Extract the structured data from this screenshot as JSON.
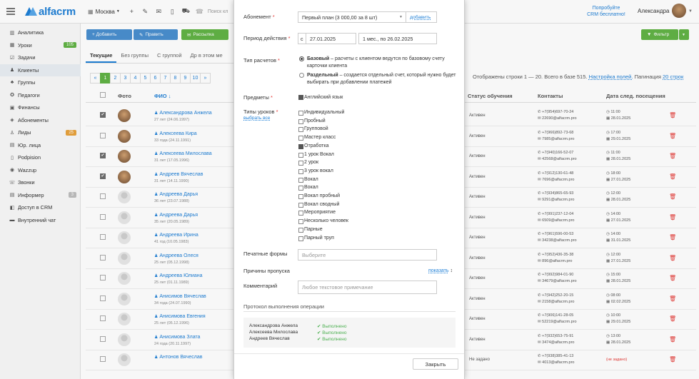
{
  "topbar": {
    "logo": "alfacrm",
    "branch": "Москва",
    "search_placeholder": "Поиск кл",
    "try_free": "Попробуйте CRM бесплатно!",
    "user": "Александра"
  },
  "sidebar": {
    "items": [
      {
        "icon": "chart-icon",
        "label": "Аналитика"
      },
      {
        "icon": "calendar-icon",
        "label": "Уроки",
        "badge": "105",
        "badge_color": "#62b346"
      },
      {
        "icon": "check-icon",
        "label": "Задачи"
      },
      {
        "icon": "user-icon",
        "label": "Клиенты"
      },
      {
        "icon": "group-icon",
        "label": "Группы"
      },
      {
        "icon": "teacher-icon",
        "label": "Педагоги"
      },
      {
        "icon": "money-icon",
        "label": "Финансы"
      },
      {
        "icon": "ticket-icon",
        "label": "Абонементы"
      },
      {
        "icon": "lead-icon",
        "label": "Лиды",
        "badge": "25",
        "badge_color": "#e8a33d"
      },
      {
        "icon": "building-icon",
        "label": "Юр. лица"
      },
      {
        "icon": "doc-icon",
        "label": "Podpision"
      },
      {
        "icon": "chat-icon",
        "label": "Wazzup"
      },
      {
        "icon": "phone-icon",
        "label": "Звонки"
      },
      {
        "icon": "info-icon",
        "label": "Информер",
        "badge": "3",
        "badge_color": "#bdbdbd"
      },
      {
        "icon": "lock-icon",
        "label": "Доступ в CRM"
      },
      {
        "icon": "chat-bubble-icon",
        "label": "Внутренний чат"
      }
    ]
  },
  "list": {
    "toolbar": {
      "add": "+ Добавить",
      "edit": "Править",
      "mailing": "Рассылка",
      "filter": "Фильтр"
    },
    "tabs": [
      "Текущие",
      "Без группы",
      "С группой",
      "Др в этом ме"
    ],
    "pages": [
      "«",
      "1",
      "2",
      "3",
      "4",
      "5",
      "6",
      "7",
      "8",
      "9",
      "10",
      "»"
    ],
    "stats_text": "Отображены строки 1 — 20. Всего в базе 515.",
    "stats_link": "Настройка полей.",
    "stats_pag": "Пагинация",
    "stats_pag_link": "20 строк",
    "headers": {
      "photo": "Фото",
      "fio": "ФИО ↓",
      "status": "Статус обучения",
      "contacts": "Контакты",
      "next": "Дата след. посещения"
    },
    "rows": [
      {
        "name": "Александрова Анжела",
        "age": "27 лет (24.06.1997)",
        "checked": true,
        "photo": true,
        "status": "Активен",
        "phone": "+7(954)697-70-24",
        "email": "22690@alfacrm.pro",
        "time": "11:00",
        "date": "28.01.2025"
      },
      {
        "name": "Алексеева Кира",
        "age": "33 года (24.11.1991)",
        "checked": false,
        "photo": true,
        "status": "Активен",
        "phone": "+7(966)892-73-68",
        "email": "7985@alfacrm.pro",
        "time": "17:00",
        "date": "29.01.2025"
      },
      {
        "name": "Алексеева Милослава",
        "age": "31 лет (17.05.1996)",
        "checked": true,
        "photo": true,
        "status": "Активен",
        "phone": "+7(940)166-52-07",
        "email": "42568@alfacrm.pro",
        "time": "11:00",
        "date": "28.01.2025"
      },
      {
        "name": "Андреев Вячеслав",
        "age": "31 лет (14.11.1990)",
        "checked": true,
        "photo": true,
        "status": "Активен",
        "phone": "+7(912)130-61-48",
        "email": "7696@alfacrm.pro",
        "time": "18:00",
        "date": "27.01.2025"
      },
      {
        "name": "Андреева Дарья",
        "age": "36 лет (23.07.1988)",
        "checked": false,
        "photo": false,
        "status": "Активен",
        "phone": "+7(934)865-65-93",
        "email": "9291@alfacrm.pro",
        "time": "12:00",
        "date": "28.01.2025"
      },
      {
        "name": "Андреева Дарья",
        "age": "35 лет (20.05.1989)",
        "checked": false,
        "photo": false,
        "status": "Активен",
        "phone": "+7(991)237-12-04",
        "email": "6509@alfacrm.pro",
        "time": "14:00",
        "date": "27.01.2025"
      },
      {
        "name": "Андреева Ирина",
        "age": "41 год (10.05.1983)",
        "checked": false,
        "photo": false,
        "status": "Активен",
        "phone": "+7(961)596-00-53",
        "email": "34238@alfacrm.pro",
        "time": "14:00",
        "date": "31.01.2025"
      },
      {
        "name": "Андреева Олеся",
        "age": "25 лет (05.12.1998)",
        "checked": false,
        "photo": false,
        "status": "Активен",
        "phone": "+7(952)436-35-38",
        "email": "896@alfacrm.pro",
        "time": "12:00",
        "date": "27.01.2025"
      },
      {
        "name": "Андреева Юлиана",
        "age": "25 лет (01.11.1989)",
        "checked": false,
        "photo": false,
        "status": "Активен",
        "phone": "+7(992)984-01-90",
        "email": "34679@alfacrm.pro",
        "time": "15:00",
        "date": "28.01.2025"
      },
      {
        "name": "Анисимов Вячеслав",
        "age": "34 года (24.07.1990)",
        "checked": false,
        "photo": false,
        "status": "Активен",
        "phone": "+7(942)252-20-15",
        "email": "2158@alfacrm.pro",
        "time": "08:00",
        "date": "02.02.2025"
      },
      {
        "name": "Анисимова Евгения",
        "age": "25 лет (05.12.1996)",
        "checked": false,
        "photo": false,
        "status": "Активен",
        "phone": "+7(906)141-28-05",
        "email": "52219@alfacrm.pro",
        "time": "10:00",
        "date": "29.01.2025"
      },
      {
        "name": "Анисимова Злата",
        "age": "24 года (20.11.1997)",
        "checked": false,
        "photo": false,
        "status": "Активен",
        "phone": "+7(932)653-75-91",
        "email": "3474@alfacrm.pro",
        "time": "13:00",
        "date": "28.01.2025"
      },
      {
        "name": "Антонов Вячеслав",
        "age": "",
        "checked": false,
        "photo": false,
        "status": "Не задано",
        "phone": "+7(938)385-41-13",
        "email": "4013@alfacrm.pro",
        "time": "",
        "date": "(не задано)"
      }
    ]
  },
  "modal": {
    "abonement_label": "Абонемент",
    "abonement_value": "Первый план (3 000,00 за 8 шт)",
    "add_link": "добавить",
    "period_label": "Период действия",
    "period_prefix": "с",
    "period_start": "27.01.2025",
    "period_end": "1 мес., по 26.02.2025",
    "calc_label": "Тип расчетов",
    "calc_base_bold": "Базовый",
    "calc_base_text": " – расчеты с клиентом ведутся по базовому счету карточки клиента",
    "calc_sep_bold": "Раздельный",
    "calc_sep_text": " – создается отдельный счет, который нужно будет выбирать при добавлении платежей",
    "subjects_label": "Предметы",
    "subject": "Английский язык",
    "lesson_types_label": "Типы уроков",
    "select_all": "выбрать все",
    "lesson_types": [
      {
        "label": "Индивидуальный",
        "checked": false
      },
      {
        "label": "Пробный",
        "checked": false
      },
      {
        "label": "Групповой",
        "checked": false
      },
      {
        "label": "Мастер класс",
        "checked": false
      },
      {
        "label": "Отработка",
        "checked": true
      },
      {
        "label": "1 урок Вокал",
        "checked": false
      },
      {
        "label": "2 урок",
        "checked": false
      },
      {
        "label": "3 урок вокал",
        "checked": false
      },
      {
        "label": "Вокал",
        "checked": false
      },
      {
        "label": "Вокал",
        "checked": false
      },
      {
        "label": "Вокал пробный",
        "checked": false
      },
      {
        "label": "Вокал сводный",
        "checked": false
      },
      {
        "label": "Мероприятие",
        "checked": false
      },
      {
        "label": "Несколько человек",
        "checked": false
      },
      {
        "label": "Парные",
        "checked": false
      },
      {
        "label": "Парный труп",
        "checked": false
      }
    ],
    "print_label": "Печатные формы",
    "print_placeholder": "Выберите",
    "absence_label": "Причины пропуска",
    "show_link": "показать",
    "comment_label": "Комментарий",
    "comment_placeholder": "Любое текстовое примечание",
    "protocol_title": "Протокол выполнения операции",
    "protocol": [
      {
        "name": "Александрова Анжела",
        "status": "✔ Выполнено"
      },
      {
        "name": "Алексеева Милослава",
        "status": "✔ Выполнено"
      },
      {
        "name": "Андреев Вячеслав",
        "status": "✔ Выполнено"
      }
    ],
    "close": "Закрыть"
  },
  "colors": {
    "accent": "#1e7fd6",
    "green": "#62b346",
    "danger": "#e53935"
  }
}
